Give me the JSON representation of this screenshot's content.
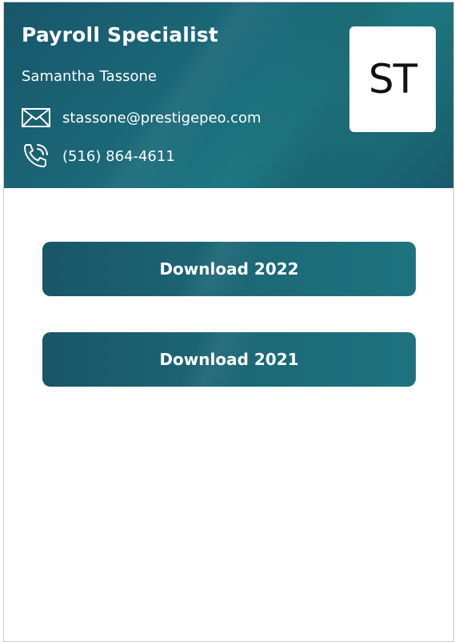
{
  "header": {
    "job_title": "Payroll Specialist",
    "name": "Samantha Tassone",
    "email": "stassone@prestigepeo.com",
    "phone": "(516) 864-4611",
    "initials": "ST",
    "email_icon": "envelope-icon",
    "phone_icon": "phone-icon"
  },
  "downloads": {
    "btn_2022_label": "Download 2022",
    "btn_2021_label": "Download 2021"
  },
  "colors": {
    "header_teal": "#1b6a7a",
    "button_teal": "#1c6776",
    "text_on_teal": "#ffffff"
  }
}
